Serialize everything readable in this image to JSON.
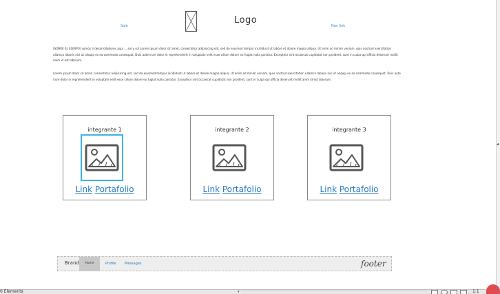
{
  "header": {
    "nav_left": "Sale",
    "nav_right": "Nav link",
    "logo": "Logo"
  },
  "content": {
    "paragraph_1": "(SOBRE EL EQUIPO) somos 3 desarrolladores aqui ... sol y sol Lorem ipsum dolor sit amet, consectetur adipisicing elit, sed do eiusmod tempor incididunt ut labore et dolore magna aliqua. Ut enim ad minim veniam, quis nostrud exercitation ullamco laboris nisi ut aliquip ex ea commodo consequat. Duis aute irure dolor in reprehenderit in voluptate velit esse cillum dolore eu fugiat nulla pariatur. Excepteur sint occaecat cupidatat non proident, sunt in culpa qui officia deserunt mollit anim id est laborum.",
    "paragraph_2": "Lorem ipsum dolor sit amet, consectetur adipisicing elit, sed do eiusmod tempor incididunt ut labore et dolore magna aliqua. Ut enim ad minim veniam, quis nostrud exercitation ullamco laboris nisi ut aliquip ex ea commodo consequat. Duis aute irure dolor in reprehenderit in voluptate velit esse cillum dolore eu fugiat nulla pariatur. Excepteur sint occaecat cupidatat non proident, sunt in culpa qui officia deserunt mollit anim id est laborum."
  },
  "cards": [
    {
      "title": "integrante 1",
      "link": "Link",
      "portfolio": "Portafolio",
      "selected": true
    },
    {
      "title": "integrante 2",
      "link": "Link",
      "portfolio": "Portafolio",
      "selected": false
    },
    {
      "title": "integrante 3",
      "link": "Link",
      "portfolio": "Portafolio",
      "selected": false
    }
  ],
  "footer": {
    "brand": "Brand",
    "items": [
      "Home",
      "Profile",
      "Messages"
    ],
    "label": "footer"
  },
  "status_bar": {
    "elements_count": "0 Elements",
    "zoom": "1:1"
  },
  "colors": {
    "link": "#2a7bc5",
    "selection": "#3fb3e0",
    "badge": "#e04b52"
  }
}
